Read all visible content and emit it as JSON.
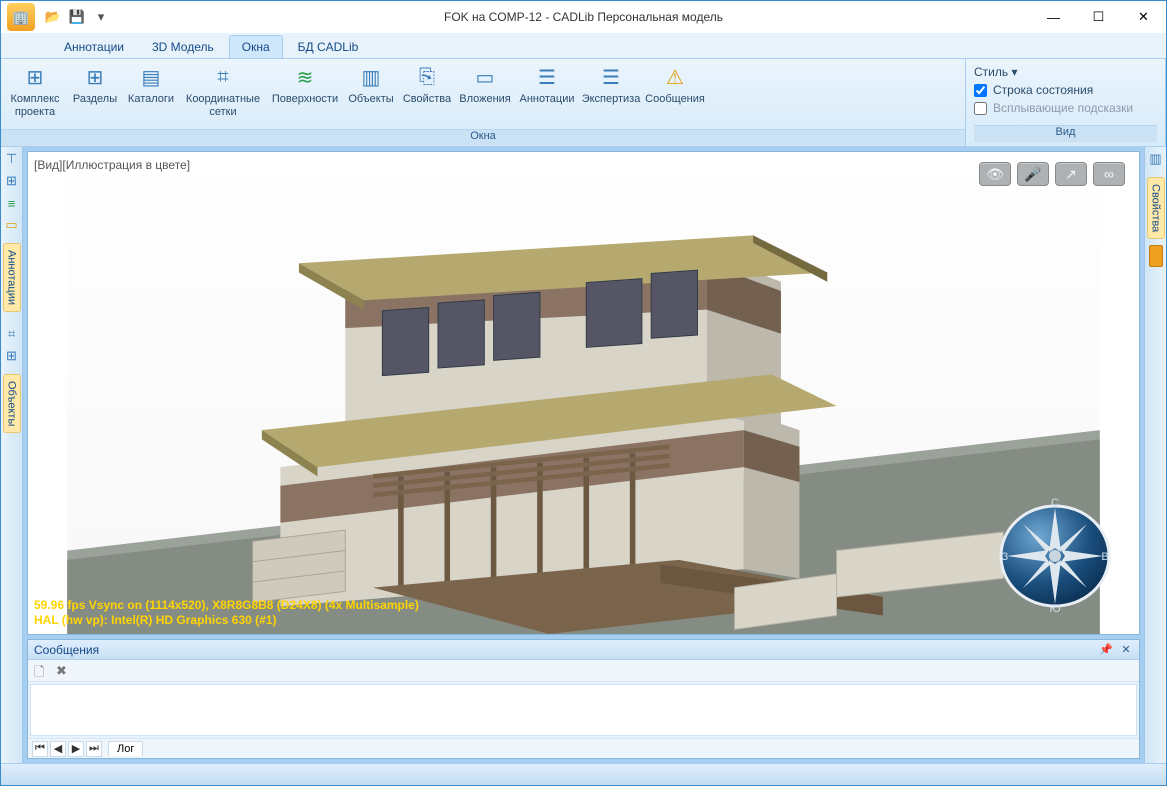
{
  "title": "FOK на COMP-12 - CADLib Персональная модель",
  "tabs": [
    "Аннотации",
    "3D Модель",
    "Окна",
    "БД CADLib"
  ],
  "active_tab_index": 2,
  "ribbon": {
    "groups": {
      "okna": {
        "title": "Окна",
        "buttons": [
          {
            "label": "Комплекс проекта",
            "icon": "⊞"
          },
          {
            "label": "Разделы",
            "icon": "⊞"
          },
          {
            "label": "Каталоги",
            "icon": "▤"
          },
          {
            "label": "Координатные сетки",
            "icon": "⌗"
          },
          {
            "label": "Поверхности",
            "icon": "≋"
          },
          {
            "label": "Объекты",
            "icon": "▥"
          },
          {
            "label": "Свойства",
            "icon": "⎘"
          },
          {
            "label": "Вложения",
            "icon": "▭"
          },
          {
            "label": "Аннотации",
            "icon": "☰"
          },
          {
            "label": "Экспертиза",
            "icon": "☰"
          },
          {
            "label": "Сообщения",
            "icon": "⚠"
          }
        ]
      },
      "vid": {
        "title": "Вид",
        "style_label": "Стиль",
        "status_row": "Строка состояния",
        "status_checked": true,
        "tooltip_row": "Всплывающие подсказки",
        "tooltip_checked": false
      }
    }
  },
  "viewport": {
    "overlay": "[Вид][Иллюстрация в цвете]",
    "perf_line1": "59.96 fps Vsync on (1114x520), X8R8G8B8 (D24X8) (4x Multisample)",
    "perf_line2": "HAL (hw vp): Intel(R) HD Graphics 630 (#1)",
    "compass": {
      "n": "С",
      "e": "В",
      "s": "Ю",
      "w": "З"
    }
  },
  "left_panel_tabs": [
    "Аннотации",
    "Объекты"
  ],
  "right_panel_tabs": [
    "Свойства"
  ],
  "messages": {
    "title": "Сообщения",
    "log_tab": "Лог"
  }
}
